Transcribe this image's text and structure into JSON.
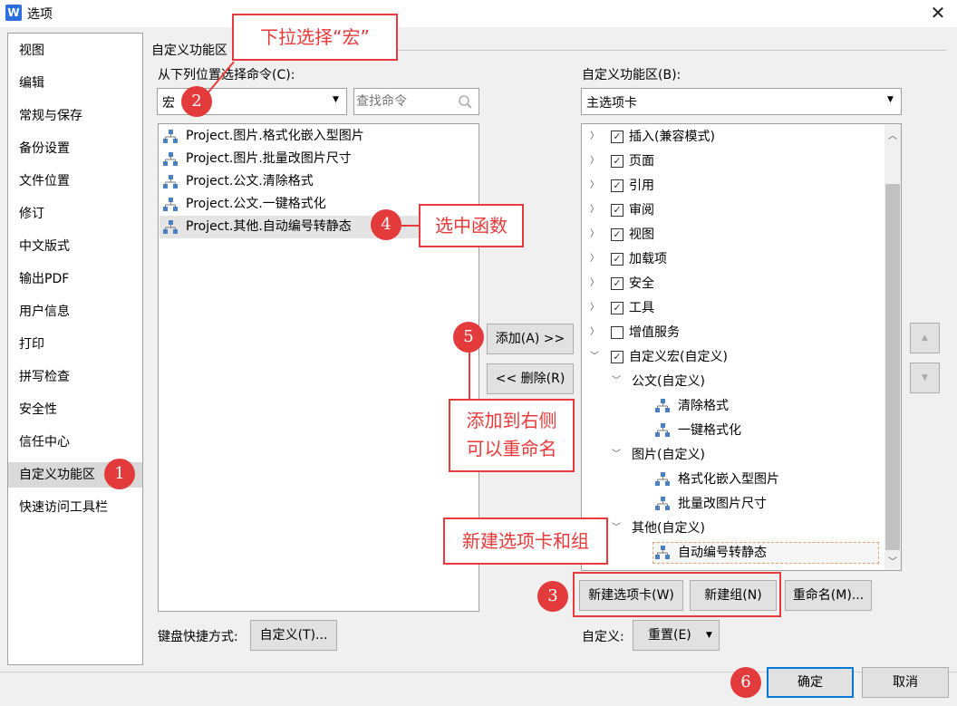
{
  "window": {
    "icon_letter": "W",
    "title": "选项",
    "close": "✕"
  },
  "nav": {
    "items": [
      "视图",
      "编辑",
      "常规与保存",
      "备份设置",
      "文件位置",
      "修订",
      "中文版式",
      "输出PDF",
      "用户信息",
      "打印",
      "拼写检查",
      "安全性",
      "信任中心",
      "自定义功能区",
      "快速访问工具栏"
    ],
    "selected": "自定义功能区"
  },
  "section_title": "自定义功能区",
  "left": {
    "label": "从下列位置选择命令(C):",
    "dropdown_value": "宏",
    "search_placeholder": "查找命令",
    "commands": [
      "Project.图片.格式化嵌入型图片",
      "Project.图片.批量改图片尺寸",
      "Project.公文.清除格式",
      "Project.公文.一键格式化",
      "Project.其他.自动编号转静态"
    ],
    "selected_command": "Project.其他.自动编号转静态",
    "shortcut_label": "键盘快捷方式:",
    "shortcut_button": "自定义(T)..."
  },
  "middle": {
    "add_button": "添加(A) >>",
    "remove_button": "<< 删除(R)"
  },
  "right": {
    "label": "自定义功能区(B):",
    "dropdown_value": "主选项卡",
    "tree": [
      {
        "label": "插入(兼容模式)",
        "checked": true,
        "expanded": false,
        "level": 0
      },
      {
        "label": "页面",
        "checked": true,
        "expanded": false,
        "level": 0
      },
      {
        "label": "引用",
        "checked": true,
        "expanded": false,
        "level": 0
      },
      {
        "label": "审阅",
        "checked": true,
        "expanded": false,
        "level": 0
      },
      {
        "label": "视图",
        "checked": true,
        "expanded": false,
        "level": 0
      },
      {
        "label": "加载项",
        "checked": true,
        "expanded": false,
        "level": 0
      },
      {
        "label": "安全",
        "checked": true,
        "expanded": false,
        "level": 0
      },
      {
        "label": "工具",
        "checked": true,
        "expanded": false,
        "level": 0
      },
      {
        "label": "增值服务",
        "checked": false,
        "expanded": false,
        "level": 0
      },
      {
        "label": "自定义宏(自定义)",
        "checked": true,
        "expanded": true,
        "level": 0
      },
      {
        "label": "公文(自定义)",
        "expanded": true,
        "level": 1
      },
      {
        "label": "清除格式",
        "level": 2
      },
      {
        "label": "一键格式化",
        "level": 2
      },
      {
        "label": "图片(自定义)",
        "expanded": true,
        "level": 1
      },
      {
        "label": "格式化嵌入型图片",
        "level": 2
      },
      {
        "label": "批量改图片尺寸",
        "level": 2
      },
      {
        "label": "其他(自定义)",
        "expanded": true,
        "level": 1
      },
      {
        "label": "自动编号转静态",
        "level": 2,
        "selected": true
      }
    ],
    "new_tab_button": "新建选项卡(W)",
    "new_group_button": "新建组(N)",
    "rename_button": "重命名(M)...",
    "customize_label": "自定义:",
    "reset_button": "重置(E)"
  },
  "footer": {
    "ok_button": "确定",
    "cancel_button": "取消"
  },
  "annotations": {
    "a2": "下拉选择“宏”",
    "a4": "选中函数",
    "a5": "添加到右侧\n可以重命名",
    "a3": "新建选项卡和组",
    "badges": [
      "1",
      "2",
      "3",
      "4",
      "5",
      "6"
    ]
  },
  "colors": {
    "annotation_red": "#e83a3a",
    "badge_red": "#e33b3b",
    "macro_icon_blue": "#4a7fc1"
  }
}
